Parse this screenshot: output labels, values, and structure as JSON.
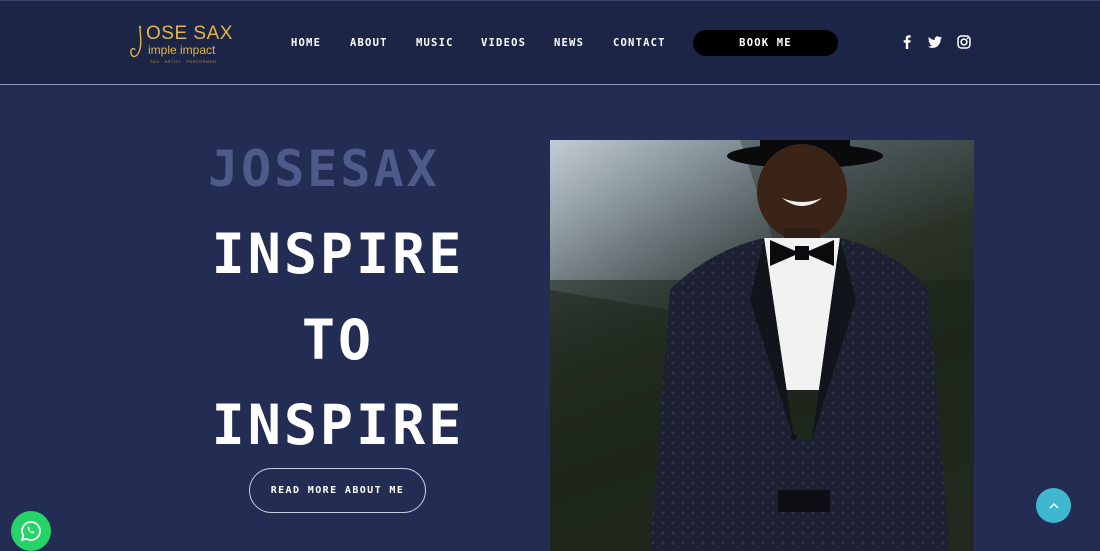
{
  "logo": {
    "line1": "OSE SAX",
    "line2": "imple impact",
    "tagline": "SAX · ARTIST · PERFORMER",
    "color": "#e3b447"
  },
  "nav": {
    "items": [
      {
        "label": "HOME"
      },
      {
        "label": "ABOUT"
      },
      {
        "label": "MUSIC"
      },
      {
        "label": "VIDEOS"
      },
      {
        "label": "NEWS"
      },
      {
        "label": "CONTACT"
      }
    ],
    "book_label": "BOOK ME"
  },
  "social": {
    "icons": [
      "facebook-icon",
      "twitter-icon",
      "instagram-icon"
    ]
  },
  "hero": {
    "kicker": "JOSESAX",
    "lines": [
      "INSPIRE",
      "TO",
      "INSPIRE"
    ],
    "cta_label": "READ MORE ABOUT ME"
  },
  "colors": {
    "background": "#232c52",
    "header": "#1d2547",
    "kicker": "#4d5a8a",
    "whatsapp": "#25d366",
    "scroll_top": "#3fb8cf"
  },
  "floating": {
    "whatsapp_icon": "whatsapp-icon",
    "scroll_top_icon": "chevron-up-icon"
  }
}
